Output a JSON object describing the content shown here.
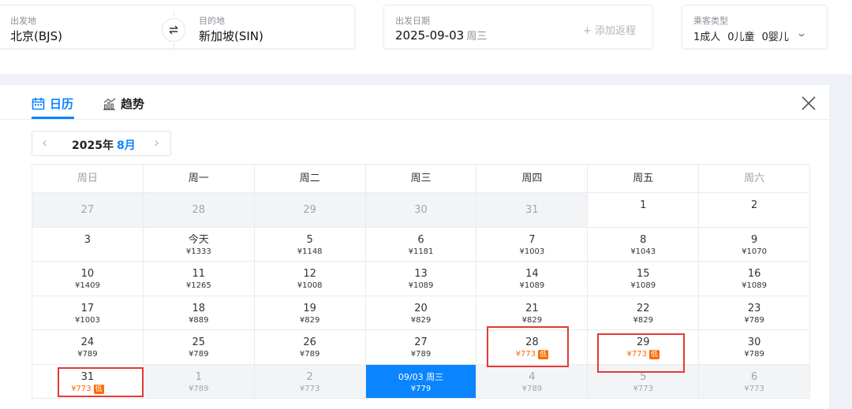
{
  "search": {
    "from_label": "出发地",
    "from_value": "北京(BJS)",
    "to_label": "目的地",
    "to_value": "新加坡(SIN)",
    "date_label": "出发日期",
    "date_value": "2025-09-03",
    "date_weekday": "周三",
    "add_return": "+ 添加返程",
    "pax_label": "乘客类型",
    "pax_adult": "1成人",
    "pax_child": "0儿童",
    "pax_infant": "0婴儿"
  },
  "tabs": {
    "calendar": "日历",
    "trend": "趋势"
  },
  "month_nav": {
    "year": "2025年",
    "month": "8月"
  },
  "weekdays": [
    "周日",
    "周一",
    "周二",
    "周三",
    "周四",
    "周五",
    "周六"
  ],
  "weeks": [
    [
      {
        "d": "27",
        "p": ""
      },
      {
        "d": "28",
        "p": ""
      },
      {
        "d": "29",
        "p": ""
      },
      {
        "d": "30",
        "p": ""
      },
      {
        "d": "31",
        "p": ""
      },
      {
        "d": "1",
        "p": ""
      },
      {
        "d": "2",
        "p": ""
      }
    ],
    [
      {
        "d": "3",
        "p": ""
      },
      {
        "d": "今天",
        "p": "¥1333"
      },
      {
        "d": "5",
        "p": "¥1148"
      },
      {
        "d": "6",
        "p": "¥1181"
      },
      {
        "d": "7",
        "p": "¥1003"
      },
      {
        "d": "8",
        "p": "¥1043"
      },
      {
        "d": "9",
        "p": "¥1070"
      }
    ],
    [
      {
        "d": "10",
        "p": "¥1409"
      },
      {
        "d": "11",
        "p": "¥1265"
      },
      {
        "d": "12",
        "p": "¥1008"
      },
      {
        "d": "13",
        "p": "¥1089"
      },
      {
        "d": "14",
        "p": "¥1089"
      },
      {
        "d": "15",
        "p": "¥1089"
      },
      {
        "d": "16",
        "p": "¥1089"
      }
    ],
    [
      {
        "d": "17",
        "p": "¥1003"
      },
      {
        "d": "18",
        "p": "¥889"
      },
      {
        "d": "19",
        "p": "¥829"
      },
      {
        "d": "20",
        "p": "¥829"
      },
      {
        "d": "21",
        "p": "¥829"
      },
      {
        "d": "22",
        "p": "¥829"
      },
      {
        "d": "23",
        "p": "¥789"
      }
    ],
    [
      {
        "d": "24",
        "p": "¥789"
      },
      {
        "d": "25",
        "p": "¥789"
      },
      {
        "d": "26",
        "p": "¥789"
      },
      {
        "d": "27",
        "p": "¥789"
      },
      {
        "d": "28",
        "p": "¥773",
        "tag": "低"
      },
      {
        "d": "29",
        "p": "¥773",
        "tag": "低"
      },
      {
        "d": "30",
        "p": "¥789"
      }
    ],
    [
      {
        "d": "31",
        "p": "¥773",
        "tag": "低"
      },
      {
        "d": "1",
        "p": "¥789"
      },
      {
        "d": "2",
        "p": "¥773"
      },
      {
        "d": "09/03 周三",
        "p": "¥779"
      },
      {
        "d": "4",
        "p": "¥789"
      },
      {
        "d": "5",
        "p": "¥773"
      },
      {
        "d": "6",
        "p": "¥773"
      }
    ]
  ],
  "colors": {
    "accent": "#0a84ff",
    "low_price": "#ff6a00",
    "highlight_box": "#e53935"
  }
}
